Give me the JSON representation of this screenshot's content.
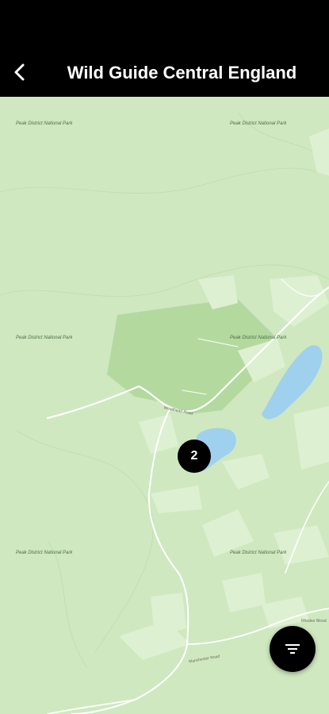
{
  "header": {
    "title": "Wild Guide Central England",
    "back_icon": "chevron-left-icon"
  },
  "map": {
    "park_labels": [
      "Peak District National Park",
      "Peak District National Park",
      "Peak District National Park",
      "Peak District National Park",
      "Peak District National Park",
      "Peak District National Park"
    ],
    "road_labels": [
      "Woodhead Road",
      "Manchester Road"
    ],
    "place_labels": [
      "Rhodes Wood"
    ],
    "cluster_marker": {
      "count": "2"
    }
  },
  "filter_button": {
    "icon": "filter-icon"
  },
  "colors": {
    "land": "#cfe8c0",
    "forest": "#b8dda6",
    "water": "#9fd0ee",
    "road": "#ffffff",
    "header": "#000000"
  }
}
